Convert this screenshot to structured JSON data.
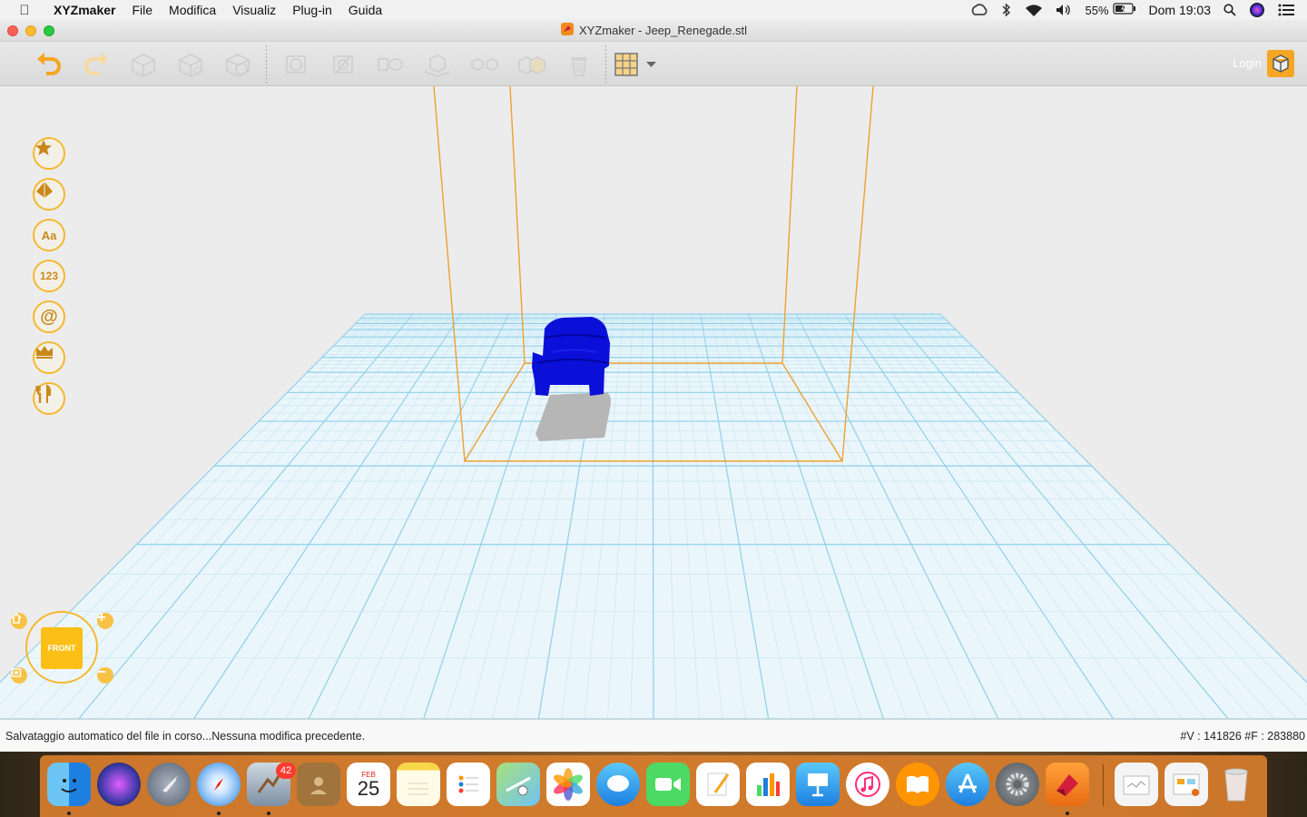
{
  "menubar": {
    "app_name": "XYZmaker",
    "items": [
      "File",
      "Modifica",
      "Visualiz",
      "Plug-in",
      "Guida"
    ],
    "battery": "55%",
    "clock": "Dom 19:03"
  },
  "window": {
    "title": "XYZmaker - Jeep_Renegade.stl"
  },
  "toolbar": {
    "login_label": "Login"
  },
  "sidebar": {
    "labels": [
      "Aa",
      "123",
      "@"
    ]
  },
  "viewcube": {
    "face_label": "FRONT"
  },
  "status": {
    "message": "Salvataggio automatico del file in corso...Nessuna modifica precedente.",
    "counts": "#V : 141826  #F : 283880"
  },
  "dock": {
    "mail_badge": "42",
    "calendar_month": "FEB",
    "calendar_day": "25"
  },
  "colors": {
    "accent": "#f5a623",
    "grid": "#8fd0ea",
    "model": "#0a10d8",
    "build_volume": "#f0a030"
  }
}
